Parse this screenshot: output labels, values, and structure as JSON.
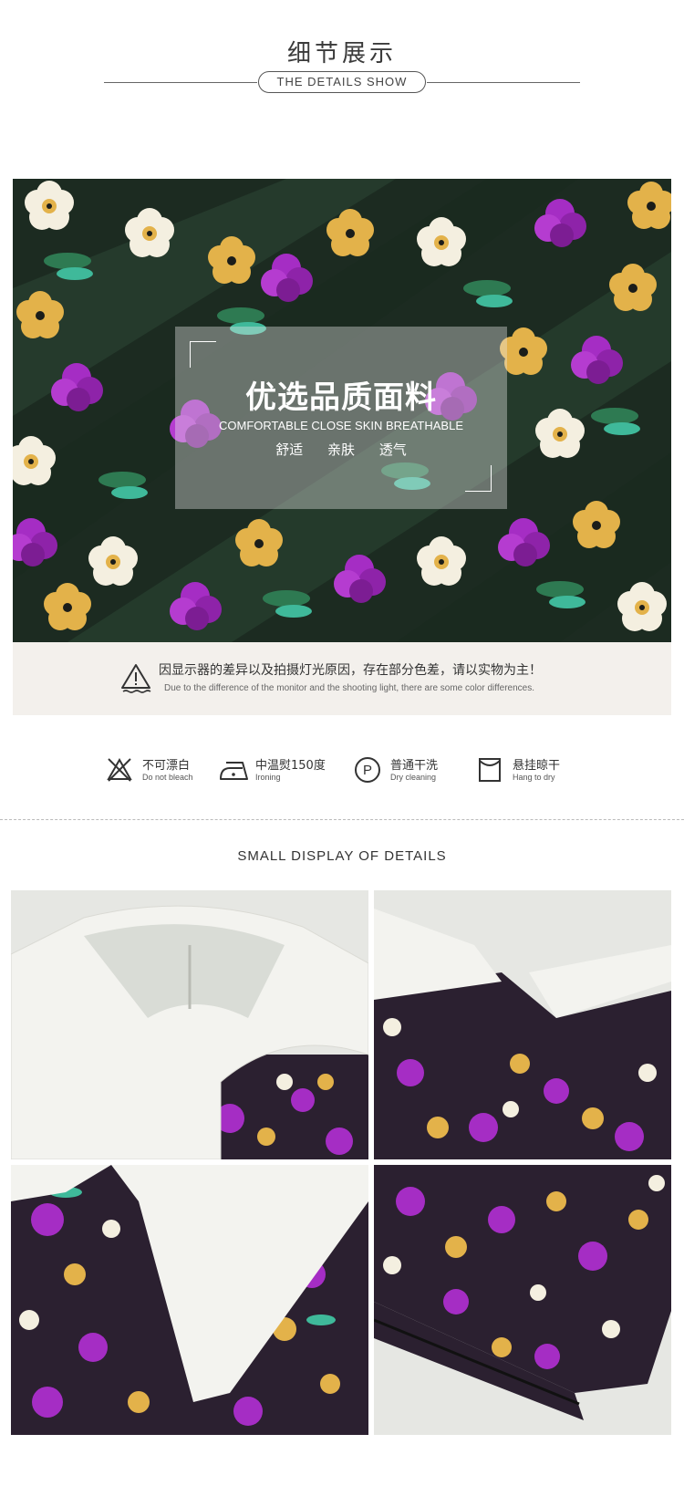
{
  "header": {
    "title_cn": "细节展示",
    "title_en": "THE DETAILS SHOW"
  },
  "hero": {
    "title": "优选品质面料",
    "subtitle": "COMFORTABLE CLOSE SKIN BREATHABLE",
    "features": "舒适 亲肤 透气"
  },
  "notice": {
    "icon": "warning-triangle-icon",
    "text_cn": "因显示器的差异以及拍摄灯光原因，存在部分色差，请以实物为主！",
    "text_en": "Due to the difference of the monitor and the shooting light, there are some color differences."
  },
  "care": [
    {
      "icon": "no-bleach-icon",
      "label_cn": "不可漂白",
      "label_en": "Do not bleach"
    },
    {
      "icon": "iron-icon",
      "label_cn": "中温熨150度",
      "label_en": "Ironing"
    },
    {
      "icon": "dry-clean-p-icon",
      "label_cn": "普通干洗",
      "label_en": "Dry cleaning"
    },
    {
      "icon": "hang-dry-icon",
      "label_cn": "悬挂晾干",
      "label_en": "Hang to dry"
    }
  ],
  "details": {
    "title": "SMALL DISPLAY OF DETAILS"
  },
  "colors": {
    "purple": "#9b2bb8",
    "yellow": "#e3b24a",
    "cream": "#f4efe0",
    "green": "#2e7a52",
    "teal": "#3fb99a",
    "dark": "#1b1d1a",
    "notice_bg": "#f3f0ec"
  }
}
